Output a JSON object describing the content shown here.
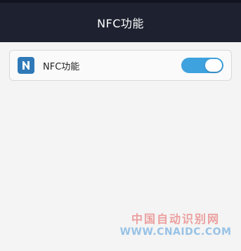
{
  "header": {
    "title": "NFC功能"
  },
  "settings": {
    "nfc_row": {
      "icon": "nfc-icon",
      "label": "NFC功能",
      "toggle_on": true,
      "accent_color": "#3ea2de"
    }
  },
  "watermark": {
    "line1": "中国自动识别网",
    "line2": "WWW.CNAIDC.COM"
  }
}
